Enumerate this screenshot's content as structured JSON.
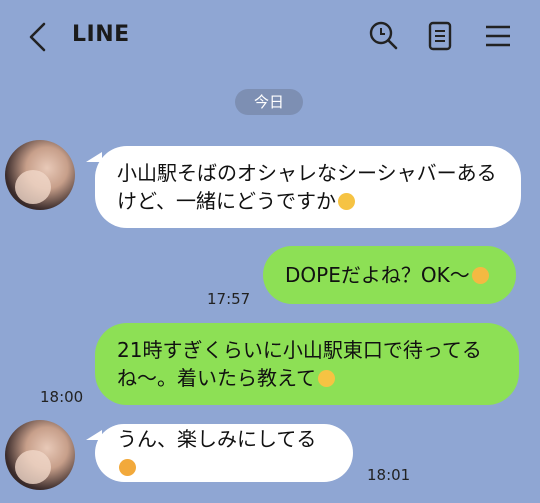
{
  "header": {
    "title": "LINE",
    "icons": [
      "back-arrow-icon",
      "search-icon",
      "notes-icon",
      "menu-icon"
    ]
  },
  "date_divider": "今日",
  "messages": [
    {
      "side": "left",
      "lines": [
        "小山駅そばのオシャレなシーシャバーある",
        "けど、一緒にどうですか"
      ],
      "emoji": "relieved-face-emoji"
    },
    {
      "side": "right",
      "text": "DOPEだよね？OK〜",
      "emoji": "ok-hand-emoji",
      "time": "17:57"
    },
    {
      "side": "right",
      "lines": [
        "21時すぎくらいに小山駅東口で待ってる",
        "ね〜。着いたら教えて"
      ],
      "emoji": "pleading-face-emoji",
      "time": "18:00"
    },
    {
      "side": "left",
      "text": "うん、楽しみにしてる",
      "emoji": "smiling-face-with-hearts-emoji",
      "time": "18:01"
    }
  ],
  "colors": {
    "background": "#8fa6d3",
    "incoming_bubble": "#ffffff",
    "outgoing_bubble": "#8de055",
    "date_pill": "#7d8fb3"
  }
}
